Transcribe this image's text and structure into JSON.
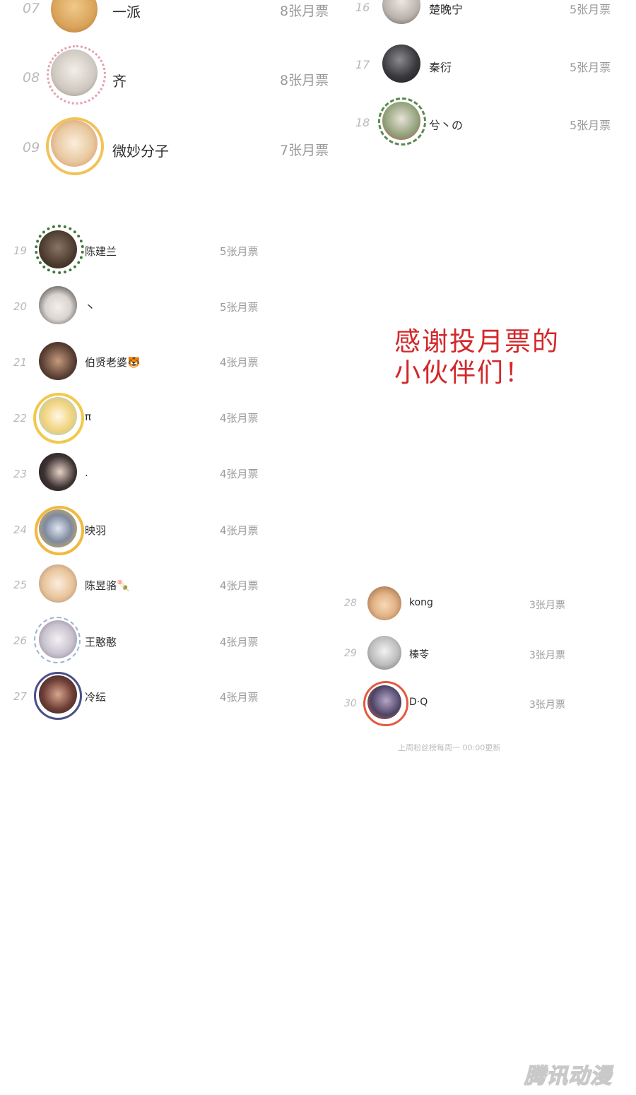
{
  "top_left": [
    {
      "rank": "07",
      "name": "一派",
      "tickets": "8张月票",
      "avatar_color": "#d9a35a",
      "icon": "dog-avatar-icon"
    },
    {
      "rank": "08",
      "name": "齐",
      "tickets": "8张月票",
      "avatar_color": "#cfc8c0",
      "icon": "flower-crown-avatar-icon"
    },
    {
      "rank": "09",
      "name": "微妙分子",
      "tickets": "7张月票",
      "avatar_color": "#e8c9a0",
      "icon": "golden-frame-avatar-icon"
    }
  ],
  "top_right": [
    {
      "rank": "16",
      "name": "楚晚宁",
      "tickets": "5张月票",
      "avatar_color": "#b9b1ab",
      "icon": "portrait-avatar-icon"
    },
    {
      "rank": "17",
      "name": "秦衍",
      "tickets": "5张月票",
      "avatar_color": "#3a3a3e",
      "icon": "dark-portrait-avatar-icon"
    },
    {
      "rank": "18",
      "name": "兮丶の",
      "tickets": "5张月票",
      "avatar_color": "#8fa07a",
      "icon": "wreath-avatar-icon"
    }
  ],
  "left_list": [
    {
      "rank": "19",
      "name": "陈建兰",
      "tickets": "5张月票",
      "avatar_color": "#4b3b2f",
      "icon": "christmas-wreath-avatar-icon"
    },
    {
      "rank": "20",
      "name": "丶",
      "tickets": "5张月票",
      "avatar_color": "#d9d4d0",
      "icon": "girl-portrait-avatar-icon"
    },
    {
      "rank": "21",
      "name": "伯贤老婆🐯",
      "tickets": "4张月票",
      "avatar_color": "#5a4034",
      "icon": "boy-portrait-avatar-icon"
    },
    {
      "rank": "22",
      "name": "π",
      "tickets": "4张月票",
      "avatar_color": "#f0d27a",
      "icon": "crown-frame-avatar-icon"
    },
    {
      "rank": "23",
      "name": ".",
      "tickets": "4张月票",
      "avatar_color": "#3d3333",
      "icon": "girl-dark-hair-avatar-icon"
    },
    {
      "rank": "24",
      "name": "映羽",
      "tickets": "4张月票",
      "avatar_color": "#e3b84d",
      "icon": "golden-frame-avatar-icon"
    },
    {
      "rank": "25",
      "name": "陈昱骆🍡",
      "tickets": "4张月票",
      "avatar_color": "#e9c39a",
      "icon": "sketch-portrait-avatar-icon"
    },
    {
      "rank": "26",
      "name": "王憨憨",
      "tickets": "4张月票",
      "avatar_color": "#c9c3cf",
      "icon": "star-frame-avatar-icon"
    },
    {
      "rank": "27",
      "name": "冷纭",
      "tickets": "4张月票",
      "avatar_color": "#6e3f36",
      "icon": "ornate-frame-avatar-icon"
    }
  ],
  "right_list": [
    {
      "rank": "28",
      "name": "kong",
      "tickets": "3张月票",
      "avatar_color": "#8a5a35",
      "icon": "cartoon-girl-avatar-icon"
    },
    {
      "rank": "29",
      "name": "榛苓",
      "tickets": "3张月票",
      "avatar_color": "#bdbdbd",
      "icon": "grey-portrait-avatar-icon"
    },
    {
      "rank": "30",
      "name": "D·Q",
      "tickets": "3张月票",
      "avatar_color": "#4c4466",
      "icon": "lucky-frame-avatar-icon"
    }
  ],
  "thanks_line1": "感谢投月票的",
  "thanks_line2": "小伙伴们！",
  "footer_note": "上周粉丝榜每周一 00:00更新",
  "watermark": "腾讯动漫",
  "colors": {
    "accent_red": "#d3282a",
    "rank_grey": "#b9b9b9",
    "tickets_grey": "#9a9a9a"
  }
}
